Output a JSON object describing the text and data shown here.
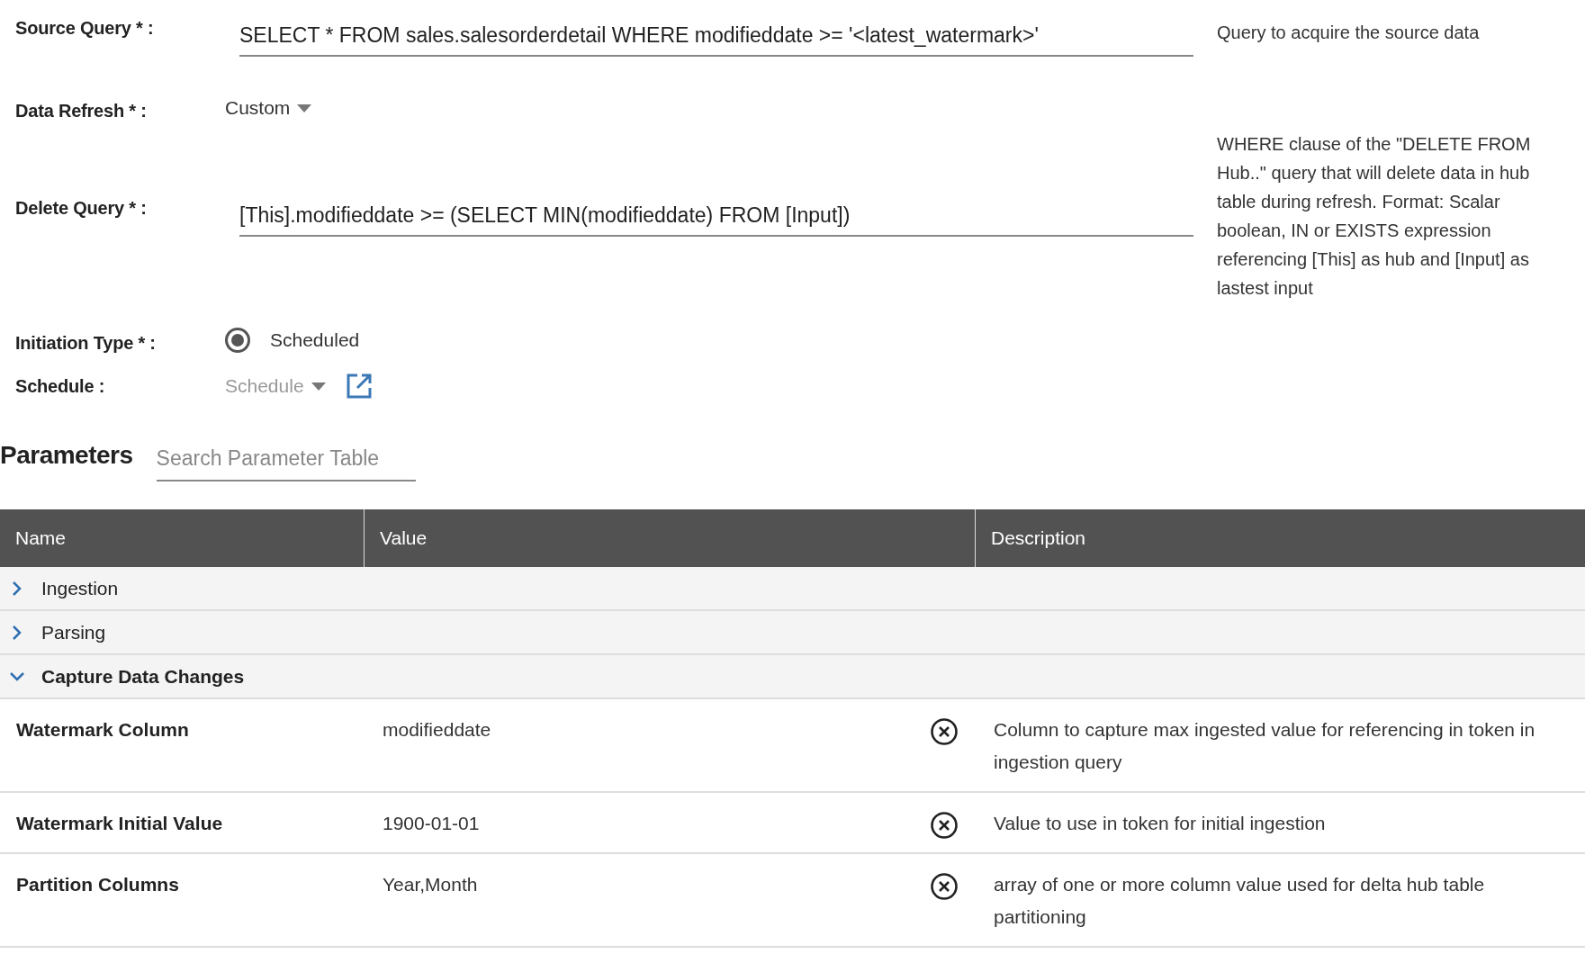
{
  "form": {
    "fields": [
      {
        "kind": "text",
        "label": "Source Query * :",
        "value": "SELECT * FROM sales.salesorderdetail WHERE modifieddate >= '<latest_watermark>'"
      },
      {
        "kind": "dropdown",
        "label": "Data Refresh * :",
        "value": "Custom",
        "disabled": false
      },
      {
        "kind": "text",
        "label": "Delete Query * :",
        "value": "[This].modifieddate >= (SELECT MIN(modifieddate) FROM [Input])"
      },
      {
        "kind": "radio",
        "label": "Initiation Type * :",
        "option": "Scheduled",
        "selected": true
      },
      {
        "kind": "dropdown-link",
        "label": "Schedule :",
        "value": "Schedule",
        "disabled": true
      }
    ],
    "help": [
      "Query to acquire the source data",
      "WHERE clause of the \"DELETE FROM Hub..\" query that will delete data in hub table during refresh. Format: Scalar boolean, IN or EXISTS expression referencing [This] as hub and [Input] as lastest input"
    ]
  },
  "parameters": {
    "title": "Parameters",
    "search": {
      "placeholder": "Search Parameter Table"
    },
    "columns": [
      "Name",
      "Value",
      "Description"
    ],
    "groups": [
      {
        "name": "Ingestion",
        "expanded": false
      },
      {
        "name": "Parsing",
        "expanded": false
      },
      {
        "name": "Capture Data Changes",
        "expanded": true,
        "rows": [
          {
            "name": "Watermark Column",
            "value": "modifieddate",
            "description": "Column to capture max ingested value for referencing in token in ingestion query"
          },
          {
            "name": "Watermark Initial Value",
            "value": "1900-01-01",
            "description": "Value to use in token for initial ingestion"
          },
          {
            "name": "Partition Columns",
            "value": "Year,Month",
            "description": "array of one or more column value used for delta hub table partitioning"
          }
        ]
      }
    ]
  }
}
